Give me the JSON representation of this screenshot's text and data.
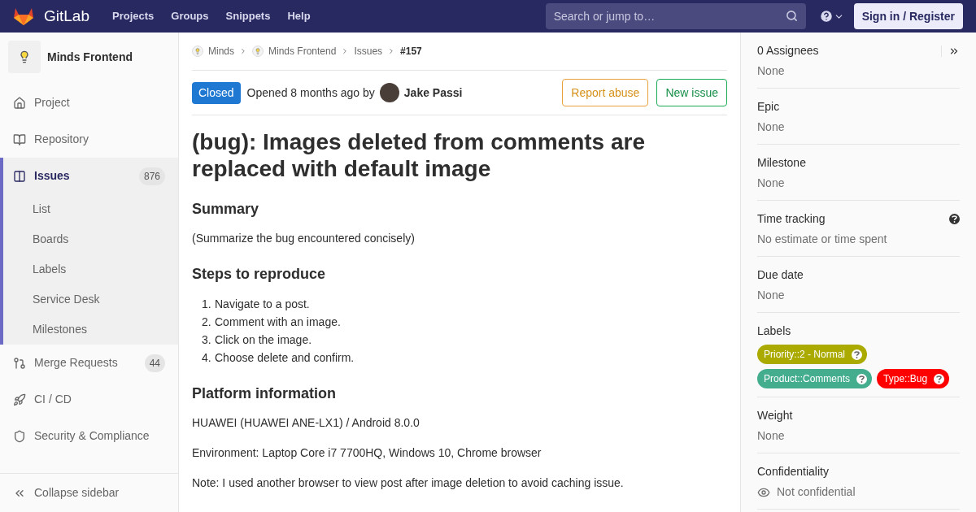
{
  "topbar": {
    "brand": "GitLab",
    "nav": [
      "Projects",
      "Groups",
      "Snippets",
      "Help"
    ],
    "search": {
      "placeholder": "Search or jump to…"
    },
    "sign_in": "Sign in / Register"
  },
  "sidebar": {
    "project": "Minds Frontend",
    "items": [
      {
        "kind": "home",
        "label": "Project",
        "selected": false
      },
      {
        "kind": "repo",
        "label": "Repository",
        "selected": false
      },
      {
        "kind": "issues",
        "label": "Issues",
        "count": "876",
        "selected": true,
        "children": [
          {
            "label": "List"
          },
          {
            "label": "Boards"
          },
          {
            "label": "Labels"
          },
          {
            "label": "Service Desk"
          },
          {
            "label": "Milestones"
          }
        ]
      },
      {
        "kind": "merge",
        "label": "Merge Requests",
        "count": "44",
        "selected": false
      },
      {
        "kind": "cicd",
        "label": "CI / CD",
        "selected": false
      },
      {
        "kind": "security",
        "label": "Security & Compliance",
        "selected": false
      }
    ],
    "collapse": "Collapse sidebar"
  },
  "breadcrumb": [
    {
      "label": "Minds",
      "avatar": true
    },
    {
      "label": "Minds Frontend",
      "avatar": true
    },
    {
      "label": "Issues",
      "avatar": false
    },
    {
      "label": "#157",
      "avatar": false
    }
  ],
  "issue": {
    "status": "Closed",
    "opened": "Opened 8 months ago by",
    "author": "Jake Passi",
    "buttons": [
      {
        "label": "Report abuse",
        "kind": "warning"
      },
      {
        "label": "New issue",
        "kind": "success"
      }
    ],
    "title": "(bug): Images deleted from comments are replaced with default image",
    "body": [
      {
        "kind": "heading",
        "text": "Summary"
      },
      {
        "kind": "paragraph",
        "text": "(Summarize the bug encountered concisely)"
      },
      {
        "kind": "heading",
        "text": "Steps to reproduce"
      },
      {
        "kind": "list",
        "items": [
          {
            "marker": "1.",
            "text": "Navigate to a post."
          },
          {
            "marker": "2.",
            "text": "Comment with an image."
          },
          {
            "marker": "3.",
            "text": "Click on the image."
          },
          {
            "marker": "4.",
            "text": "Choose delete and confirm."
          }
        ]
      },
      {
        "kind": "heading",
        "text": "Platform information"
      },
      {
        "kind": "paragraph",
        "text": "HUAWEI (HUAWEI ANE-LX1) / Android 8.0.0"
      },
      {
        "kind": "paragraph",
        "text": "Environment: Laptop Core i7 7700HQ, Windows 10, Chrome browser"
      },
      {
        "kind": "paragraph",
        "text": "Note: I used another browser to view post after image deletion to avoid caching issue."
      }
    ]
  },
  "right_sidebar": {
    "blocks": [
      {
        "kind": "assignees",
        "title": "0 Assignees",
        "value": "None"
      },
      {
        "kind": "plain",
        "title": "Epic",
        "value": "None"
      },
      {
        "kind": "plain",
        "title": "Milestone",
        "value": "None"
      },
      {
        "kind": "help",
        "title": "Time tracking",
        "value": "No estimate or time spent"
      },
      {
        "kind": "plain",
        "title": "Due date",
        "value": "None"
      },
      {
        "kind": "labels",
        "title": "Labels",
        "labels": [
          {
            "text": "Priority::2 - Normal",
            "color": "#aaaa00"
          },
          {
            "text": "Product::Comments",
            "color": "#44ad8e"
          },
          {
            "text": "Type::Bug",
            "color": "#ff0000"
          }
        ]
      },
      {
        "kind": "plain",
        "title": "Weight",
        "value": "None"
      },
      {
        "kind": "eye",
        "title": "Confidentiality",
        "value": "Not confidential"
      }
    ]
  }
}
